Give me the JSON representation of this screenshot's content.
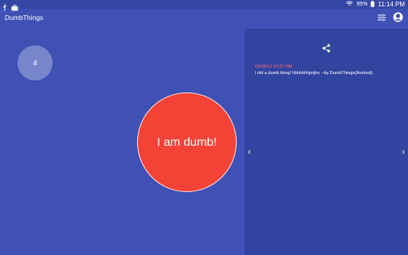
{
  "status_bar": {
    "battery": "95%",
    "time": "11:14 PM"
  },
  "app_bar": {
    "title": "DumbThings"
  },
  "counter": {
    "value": "4"
  },
  "main": {
    "button_label": "I am dumb!"
  },
  "panel": {
    "post_timestamp": "02/08/16 10:57 PM",
    "post_text": "I did a dumb thing! hbhhbhhjmjhn --by DumbThings(Android)",
    "prev_arrow": "‹",
    "next_arrow": "›"
  },
  "colors": {
    "background": "#3f51b5",
    "panel": "#3243a0",
    "button": "#f44336",
    "timestamp": "#ff6e6e"
  },
  "icons": [
    "usb-icon",
    "briefcase-icon",
    "wifi-icon",
    "battery-icon",
    "sliders-icon",
    "avatar-icon",
    "share-icon",
    "chevron-left-icon",
    "chevron-right-icon"
  ]
}
